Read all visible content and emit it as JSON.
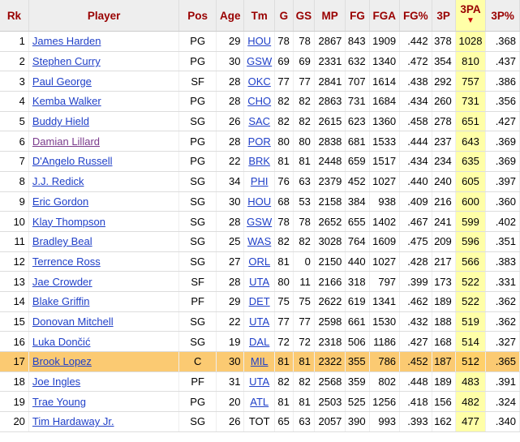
{
  "columns": [
    "Rk",
    "Player",
    "Pos",
    "Age",
    "Tm",
    "G",
    "GS",
    "MP",
    "FG",
    "FGA",
    "FG%",
    "3P",
    "3PA",
    "3P%"
  ],
  "sort_arrow": "▼",
  "rows": [
    {
      "rk": "1",
      "player": "James Harden",
      "pos": "PG",
      "age": "29",
      "tm": "HOU",
      "g": "78",
      "gs": "78",
      "mp": "2867",
      "fg": "843",
      "fga": "1909",
      "fgp": ".442",
      "tp": "378",
      "tpa": "1028",
      "tpp": ".368"
    },
    {
      "rk": "2",
      "player": "Stephen Curry",
      "pos": "PG",
      "age": "30",
      "tm": "GSW",
      "g": "69",
      "gs": "69",
      "mp": "2331",
      "fg": "632",
      "fga": "1340",
      "fgp": ".472",
      "tp": "354",
      "tpa": "810",
      "tpp": ".437"
    },
    {
      "rk": "3",
      "player": "Paul George",
      "pos": "SF",
      "age": "28",
      "tm": "OKC",
      "g": "77",
      "gs": "77",
      "mp": "2841",
      "fg": "707",
      "fga": "1614",
      "fgp": ".438",
      "tp": "292",
      "tpa": "757",
      "tpp": ".386"
    },
    {
      "rk": "4",
      "player": "Kemba Walker",
      "pos": "PG",
      "age": "28",
      "tm": "CHO",
      "g": "82",
      "gs": "82",
      "mp": "2863",
      "fg": "731",
      "fga": "1684",
      "fgp": ".434",
      "tp": "260",
      "tpa": "731",
      "tpp": ".356"
    },
    {
      "rk": "5",
      "player": "Buddy Hield",
      "pos": "SG",
      "age": "26",
      "tm": "SAC",
      "g": "82",
      "gs": "82",
      "mp": "2615",
      "fg": "623",
      "fga": "1360",
      "fgp": ".458",
      "tp": "278",
      "tpa": "651",
      "tpp": ".427"
    },
    {
      "rk": "6",
      "player": "Damian Lillard",
      "pos": "PG",
      "age": "28",
      "tm": "POR",
      "g": "80",
      "gs": "80",
      "mp": "2838",
      "fg": "681",
      "fga": "1533",
      "fgp": ".444",
      "tp": "237",
      "tpa": "643",
      "tpp": ".369"
    },
    {
      "rk": "7",
      "player": "D'Angelo Russell",
      "pos": "PG",
      "age": "22",
      "tm": "BRK",
      "g": "81",
      "gs": "81",
      "mp": "2448",
      "fg": "659",
      "fga": "1517",
      "fgp": ".434",
      "tp": "234",
      "tpa": "635",
      "tpp": ".369"
    },
    {
      "rk": "8",
      "player": "J.J. Redick",
      "pos": "SG",
      "age": "34",
      "tm": "PHI",
      "g": "76",
      "gs": "63",
      "mp": "2379",
      "fg": "452",
      "fga": "1027",
      "fgp": ".440",
      "tp": "240",
      "tpa": "605",
      "tpp": ".397"
    },
    {
      "rk": "9",
      "player": "Eric Gordon",
      "pos": "SG",
      "age": "30",
      "tm": "HOU",
      "g": "68",
      "gs": "53",
      "mp": "2158",
      "fg": "384",
      "fga": "938",
      "fgp": ".409",
      "tp": "216",
      "tpa": "600",
      "tpp": ".360"
    },
    {
      "rk": "10",
      "player": "Klay Thompson",
      "pos": "SG",
      "age": "28",
      "tm": "GSW",
      "g": "78",
      "gs": "78",
      "mp": "2652",
      "fg": "655",
      "fga": "1402",
      "fgp": ".467",
      "tp": "241",
      "tpa": "599",
      "tpp": ".402"
    },
    {
      "rk": "11",
      "player": "Bradley Beal",
      "pos": "SG",
      "age": "25",
      "tm": "WAS",
      "g": "82",
      "gs": "82",
      "mp": "3028",
      "fg": "764",
      "fga": "1609",
      "fgp": ".475",
      "tp": "209",
      "tpa": "596",
      "tpp": ".351"
    },
    {
      "rk": "12",
      "player": "Terrence Ross",
      "pos": "SG",
      "age": "27",
      "tm": "ORL",
      "g": "81",
      "gs": "0",
      "mp": "2150",
      "fg": "440",
      "fga": "1027",
      "fgp": ".428",
      "tp": "217",
      "tpa": "566",
      "tpp": ".383"
    },
    {
      "rk": "13",
      "player": "Jae Crowder",
      "pos": "SF",
      "age": "28",
      "tm": "UTA",
      "g": "80",
      "gs": "11",
      "mp": "2166",
      "fg": "318",
      "fga": "797",
      "fgp": ".399",
      "tp": "173",
      "tpa": "522",
      "tpp": ".331"
    },
    {
      "rk": "14",
      "player": "Blake Griffin",
      "pos": "PF",
      "age": "29",
      "tm": "DET",
      "g": "75",
      "gs": "75",
      "mp": "2622",
      "fg": "619",
      "fga": "1341",
      "fgp": ".462",
      "tp": "189",
      "tpa": "522",
      "tpp": ".362"
    },
    {
      "rk": "15",
      "player": "Donovan Mitchell",
      "pos": "SG",
      "age": "22",
      "tm": "UTA",
      "g": "77",
      "gs": "77",
      "mp": "2598",
      "fg": "661",
      "fga": "1530",
      "fgp": ".432",
      "tp": "188",
      "tpa": "519",
      "tpp": ".362"
    },
    {
      "rk": "16",
      "player": "Luka Dončić",
      "pos": "SG",
      "age": "19",
      "tm": "DAL",
      "g": "72",
      "gs": "72",
      "mp": "2318",
      "fg": "506",
      "fga": "1186",
      "fgp": ".427",
      "tp": "168",
      "tpa": "514",
      "tpp": ".327"
    },
    {
      "rk": "17",
      "player": "Brook Lopez",
      "pos": "C",
      "age": "30",
      "tm": "MIL",
      "g": "81",
      "gs": "81",
      "mp": "2322",
      "fg": "355",
      "fga": "786",
      "fgp": ".452",
      "tp": "187",
      "tpa": "512",
      "tpp": ".365"
    },
    {
      "rk": "18",
      "player": "Joe Ingles",
      "pos": "PF",
      "age": "31",
      "tm": "UTA",
      "g": "82",
      "gs": "82",
      "mp": "2568",
      "fg": "359",
      "fga": "802",
      "fgp": ".448",
      "tp": "189",
      "tpa": "483",
      "tpp": ".391"
    },
    {
      "rk": "19",
      "player": "Trae Young",
      "pos": "PG",
      "age": "20",
      "tm": "ATL",
      "g": "81",
      "gs": "81",
      "mp": "2503",
      "fg": "525",
      "fga": "1256",
      "fgp": ".418",
      "tp": "156",
      "tpa": "482",
      "tpp": ".324"
    },
    {
      "rk": "20",
      "player": "Tim Hardaway Jr.",
      "pos": "SG",
      "age": "26",
      "tm": "TOT",
      "g": "65",
      "gs": "63",
      "mp": "2057",
      "fg": "390",
      "fga": "993",
      "fgp": ".393",
      "tp": "162",
      "tpa": "477",
      "tpp": ".340"
    }
  ],
  "highlighted_row": 16,
  "visited_row": 5,
  "unlinked_team_rows": [
    19
  ],
  "colors": {
    "header_text": "#990000",
    "link": "#2040c8",
    "visited_link": "#7a3a8c",
    "highlight_row": "#fbca72",
    "sorted_column": "#ffffa8"
  }
}
